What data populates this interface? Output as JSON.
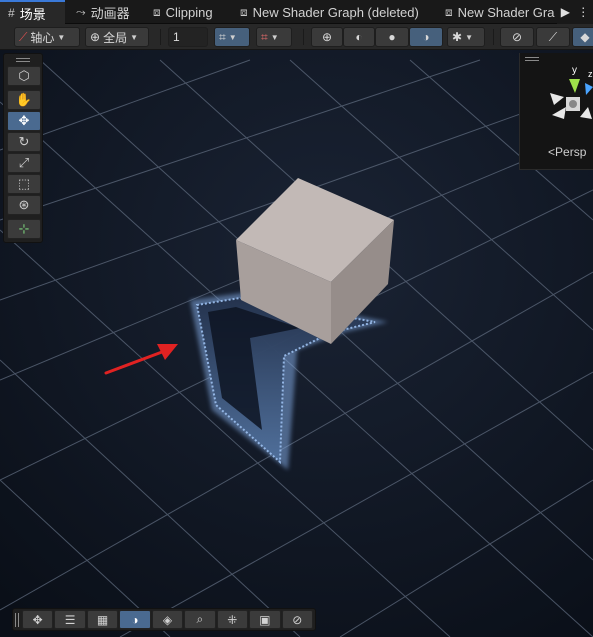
{
  "tabs": [
    {
      "label": "场景",
      "icon": "grid-icon",
      "active": true
    },
    {
      "label": "动画器",
      "icon": "animator-icon",
      "active": false
    },
    {
      "label": "Clipping",
      "icon": "shader-graph-icon",
      "active": false
    },
    {
      "label": "New Shader Graph (deleted)",
      "icon": "shader-graph-icon",
      "active": false
    },
    {
      "label": "New Shader Gra",
      "icon": "shader-graph-icon",
      "active": false
    }
  ],
  "toolbar": {
    "pivot_label": "轴心",
    "space_label": "全局",
    "grid_size_value": "1"
  },
  "gizmo": {
    "y_axis_label": "y",
    "z_axis_label": "z",
    "projection_label": "Persp"
  },
  "colors": {
    "viewport_bg": "#0e1522",
    "cube_top": "#c2b9b6",
    "cube_front": "#a89f9c",
    "cube_side": "#968d8a",
    "shadow_glow": "#6f9ad6",
    "arrow": "#e02222",
    "selection_blue": "#4a6a90"
  }
}
